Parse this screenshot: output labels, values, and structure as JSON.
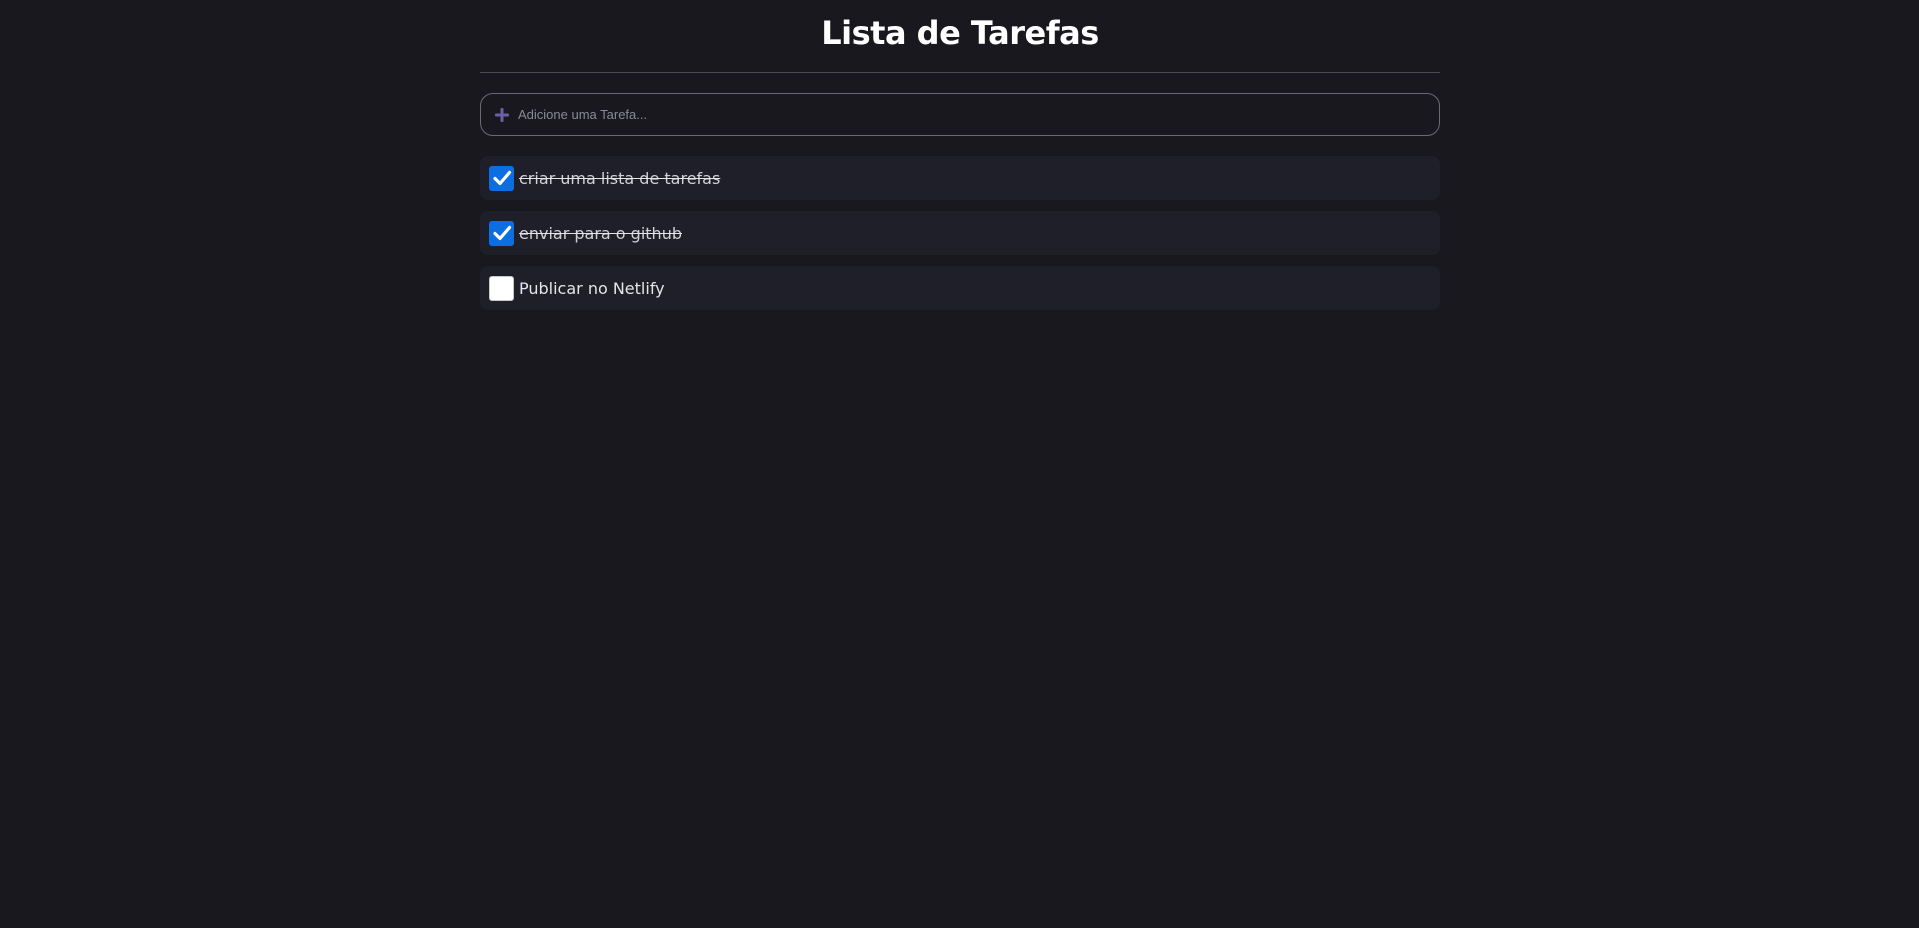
{
  "header": {
    "title": "Lista de Tarefas"
  },
  "add_task": {
    "icon": "plus-icon",
    "placeholder": "Adicione uma Tarefa...",
    "value": ""
  },
  "tasks": [
    {
      "text": "criar uma lista de tarefas",
      "done": true
    },
    {
      "text": "enviar para o github",
      "done": true
    },
    {
      "text": "Publicar no Netlify",
      "done": false
    }
  ],
  "colors": {
    "background": "#18181e",
    "task_background": "#1f1f29",
    "checkbox_checked": "#0b6ee3",
    "plus_icon": "#6b5fa6"
  }
}
